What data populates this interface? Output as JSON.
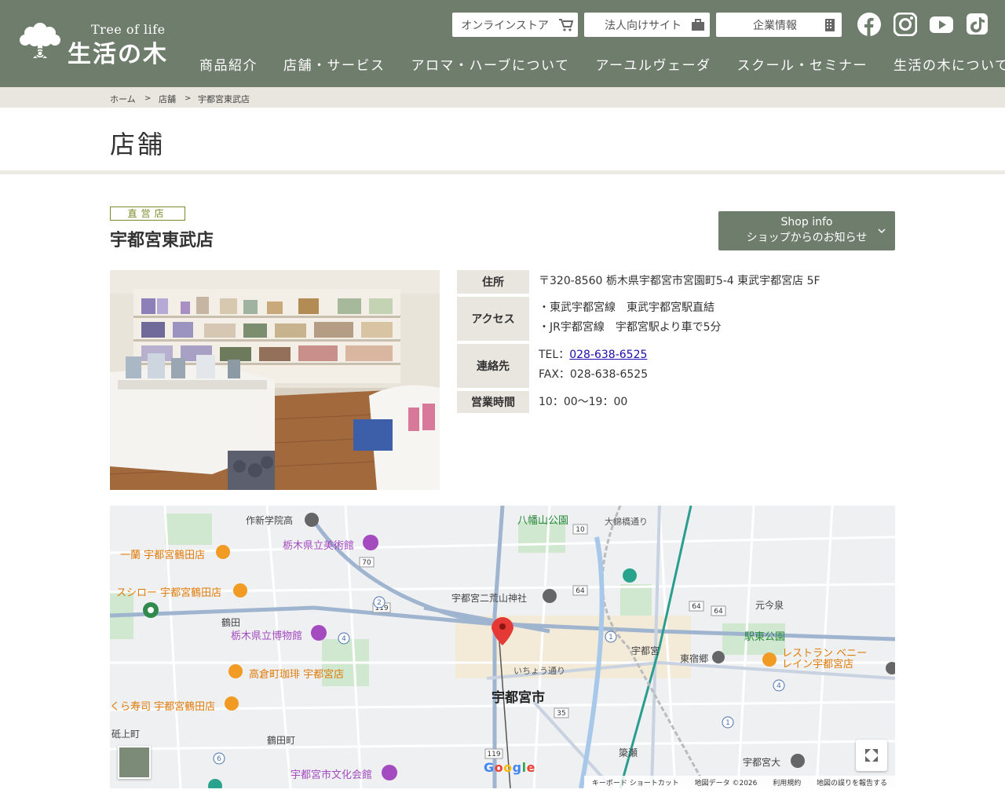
{
  "header": {
    "logo_en": "Tree of life",
    "logo_ja": "生活の木",
    "top_links": [
      {
        "label": "オンラインストア",
        "icon": "cart-icon"
      },
      {
        "label": "法人向けサイト",
        "icon": "briefcase-icon"
      },
      {
        "label": "企業情報",
        "icon": "building-icon"
      }
    ],
    "sns": [
      "facebook-icon",
      "instagram-icon",
      "youtube-icon",
      "tiktok-icon"
    ],
    "nav": [
      "商品紹介",
      "店舗・サービス",
      "アロマ・ハーブについて",
      "アーユルヴェーダ",
      "スクール・セミナー",
      "生活の木について"
    ]
  },
  "breadcrumb": {
    "home": "ホーム",
    "sep": ">",
    "stores": "店舗",
    "current": "宇都宮東武店"
  },
  "page": {
    "title": "店舗"
  },
  "shop": {
    "tag": "直営店",
    "name": "宇都宮東武店",
    "info_button_line1": "Shop info",
    "info_button_line2": "ショップからのお知らせ",
    "rows": {
      "address_label": "住所",
      "address_value": "〒320-8560 栃木県宇都宮市宮園町5-4 東武宇都宮店 5F",
      "access_label": "アクセス",
      "access_line1": "・東武宇都宮線　東武宇都宮駅直結",
      "access_line2": "・JR宇都宮線　宇都宮駅より車で5分",
      "contact_label": "連絡先",
      "tel_prefix": "TEL：",
      "tel": "028-638-6525",
      "fax": "FAX：028-638-6525",
      "hours_label": "営業時間",
      "hours_value": "10：00～19：00"
    }
  },
  "map": {
    "labels": {
      "sakushin": "作新学院高",
      "hachiman": "八幡山公園",
      "ookusa": "大錦橋通り",
      "ichiran": "一蘭 宇都宮鶴田店",
      "museum_art": "栃木県立美術館",
      "sushiro": "スシロー 宇都宮鶴田店",
      "futaarayama": "宇都宮二荒山神社",
      "tsuruta": "鶴田",
      "museum_pref": "栃木県立博物館",
      "takakura": "高倉町珈琲 宇都宮店",
      "kura": "くら寿司 宇都宮鶴田店",
      "utsunomiya_city": "宇都宮市",
      "ekihigashi": "駅東公園",
      "utsunomiya": "宇都宮",
      "higashijuku": "東宿郷",
      "restaurant": "レストラン ベニー\nレイン宇都宮店",
      "motoimaizumi": "元今泉",
      "tsurutamachi": "鶴田町",
      "bunka": "宇都宮市文化会館",
      "toishikami": "砥上町",
      "yanase": "簗瀬",
      "utsunomiya_univ": "宇都宮大",
      "ichou": "いちょう通り",
      "keyboard": "キーボード ショートカット",
      "mapdata": "地図データ ©2026",
      "terms": "利用規約",
      "report": "地図の誤りを報告する"
    }
  }
}
